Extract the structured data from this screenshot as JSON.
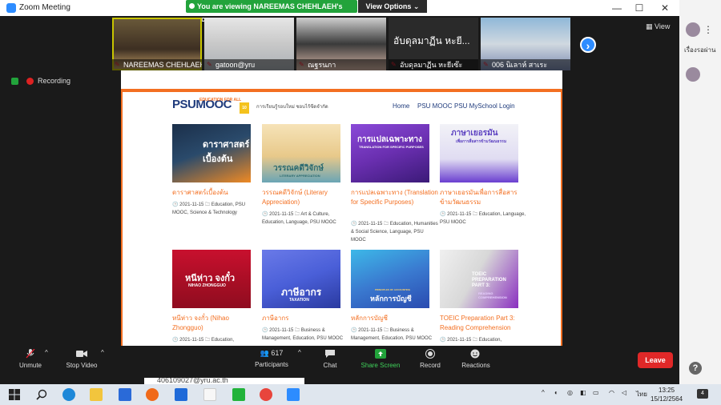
{
  "window": {
    "title": "Zoom Meeting",
    "controls": [
      "—",
      "☐",
      "✕"
    ]
  },
  "banner": {
    "viewing_text": "You are viewing NAREEMAS CHEHLAEH's screen",
    "view_options": "View Options ⌄"
  },
  "participants_strip": [
    {
      "name": "NAREEMAS CHEHLAEH",
      "active": true
    },
    {
      "name": "gatoon@yru",
      "active": false
    },
    {
      "name": "ณฐรนภา",
      "active": false
    },
    {
      "name": "อับดุลมาฏีน หะยีเซ๊ะ",
      "big_text": "อับดุลมาฏีน หะยี...",
      "active": false
    },
    {
      "name": "006 นิเลาห์ สาเระ",
      "active": false
    }
  ],
  "view_button": "View",
  "recording": {
    "label": "Recording"
  },
  "shared_page": {
    "logo": {
      "psu": "PSU",
      "mooc": "MOOC",
      "tagline": "EDUCATION FOR ALL",
      "badge": "10",
      "sub": "การเรียนรู้รอบใหม่ ชอบไร้ขีดจำกัด"
    },
    "nav": [
      "Home",
      "PSU MOOC",
      "PSU MySchool",
      "Login"
    ],
    "courses": [
      {
        "image_title": "ดาราศาสตร์เบื้องต้น",
        "image_sub": "",
        "title": "ดาราศาสตร์เบื้องต้น",
        "meta": "🕒 2021-11-15  🗀 Education, PSU MOOC, Science & Technology",
        "colors": [
          "#1b2f4a",
          "#f08a24"
        ]
      },
      {
        "image_title": "วรรณคดีวิจักษ์",
        "image_sub": "LITERARY APPRECIATION",
        "title": "วรรณคดีวิจักษ์ (Literary Appreciation)",
        "meta": "🕒 2021-11-15  🗀 Art & Culture, Education, Language, PSU MOOC",
        "colors": [
          "#f6e3b8",
          "#6aa5b5"
        ]
      },
      {
        "image_title": "การแปลเฉพาะทาง",
        "image_sub": "TRANSLATION FOR SPECIFIC PURPOSES",
        "title": "การแปลเฉพาะทาง (Translation for Specific Purposes)",
        "meta": "🕒 2021-11-15  🗀 Education, Humanities & Social Science, Language, PSU MOOC",
        "colors": [
          "#6a2fb0",
          "#3b1a78"
        ]
      },
      {
        "image_title": "ภาษาเยอรมัน",
        "image_sub": "เพื่อการสื่อสารข้ามวัฒนธรรม",
        "title": "ภาษาเยอรมันเพื่อการสื่อสารข้ามวัฒนธรรม",
        "meta": "🕒 2021-11-15  🗀 Education, Language, PSU MOOC",
        "colors": [
          "#f2f2f7",
          "#6a3fd0"
        ]
      },
      {
        "image_title": "หนีห่าว จงกั๋ว",
        "image_sub": "NIHAO ZHONGGUO",
        "title": "หนีห่าว จงกั๋ว (Nihao Zhongguo)",
        "meta": "🕒 2021-11-15  🗀 Education,",
        "colors": [
          "#c8102e",
          "#8f0c20"
        ]
      },
      {
        "image_title": "ภาษีอากร",
        "image_sub": "TAXATION",
        "title": "ภาษีอากร",
        "meta": "🕒 2021-11-15  🗀 Business & Management, Education, PSU MOOC",
        "colors": [
          "#4a5fd8",
          "#2a3aa0"
        ]
      },
      {
        "image_title": "หลักการบัญชี",
        "image_sub": "PRINCIPLES OF ACCOUNTING",
        "title": "หลักการบัญชี",
        "meta": "🕒 2021-11-15  🗀 Business & Management, Education, PSU MOOC",
        "colors": [
          "#3db8e8",
          "#2a4bb0"
        ]
      },
      {
        "image_title": "TOEIC PREPARATION PART 3:",
        "image_sub": "READING COMPREHENSION",
        "title": "TOEIC Preparation Part 3: Reading Comprehension",
        "meta": "🕒 2021-11-15  🗀 Education,",
        "colors": [
          "#f0f0f0",
          "#8a2fc0"
        ]
      }
    ]
  },
  "toolbar": {
    "unmute": "Unmute",
    "stop_video": "Stop Video",
    "participants": "Participants",
    "participants_count": "617",
    "chat": "Chat",
    "share_screen": "Share Screen",
    "record": "Record",
    "reactions": "Reactions",
    "leave": "Leave"
  },
  "background": {
    "right_text": "เรื่องรอผ่าน",
    "bottom_text": "406109027@yru.ac.th"
  },
  "taskbar": {
    "lang": "ไทย",
    "time": "13:25",
    "date": "15/12/2564",
    "notifications": "4"
  }
}
